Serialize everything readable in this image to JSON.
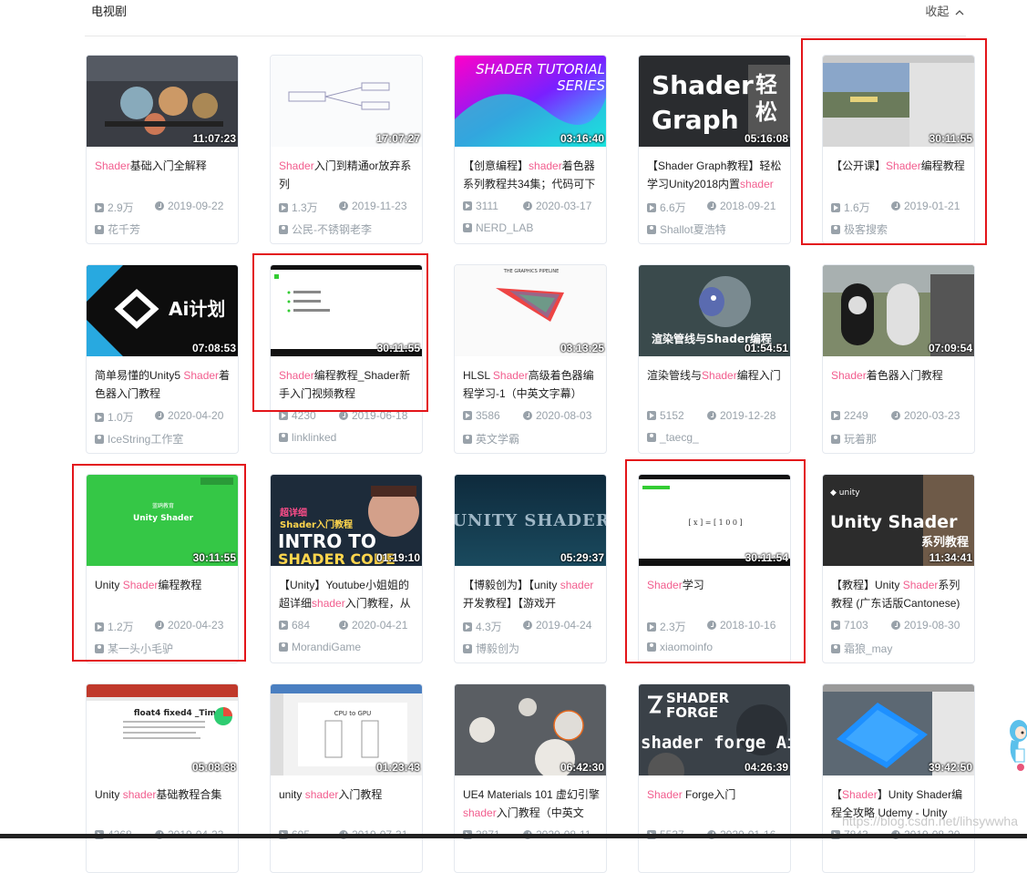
{
  "header": {
    "title": "电视剧",
    "collapse_label": "收起",
    "collapse_icon": "chevron-up-icon"
  },
  "accent_color": "#f25d8e",
  "highlight_color": "#e3151a",
  "watermark": "https://blog.csdn.net/lihsywwha",
  "cards": [
    {
      "duration": "11:07:23",
      "title_kw": "Shader",
      "title_rest": "基础入门全解释",
      "title_pre": "",
      "views": "2.9万",
      "date": "2019-09-22",
      "uploader": "花千芳",
      "thumb": "balls"
    },
    {
      "duration": "17:07:27",
      "title_pre": "",
      "title_kw": "Shader",
      "title_rest": "入门到精通or放弃系列",
      "views": "1.3万",
      "date": "2019-11-23",
      "uploader": "公民-不锈钢老李",
      "thumb": "mindmap"
    },
    {
      "duration": "03:16:40",
      "title_pre": "【创意编程】",
      "title_kw": "shader",
      "title_rest": "着色器系列教程共34集；代码可下",
      "views": "3111",
      "date": "2020-03-17",
      "uploader": "NERD_LAB",
      "thumb": "gradient",
      "thumb_text": "SHADER TUTORIAL SERIES"
    },
    {
      "duration": "05:16:08",
      "title_pre": "【Shader Graph教程】轻松学习Unity2018内置",
      "title_kw": "shader",
      "title_rest": "",
      "views": "6.6万",
      "date": "2018-09-21",
      "uploader": "Shallot夏浩特",
      "thumb": "graph",
      "thumb_text": "Shader Graph 轻松学"
    },
    {
      "duration": "30:11:55",
      "title_pre": "【公开课】",
      "title_kw": "Shader",
      "title_rest": "编程教程",
      "views": "1.6万",
      "date": "2019-01-21",
      "uploader": "极客搜索",
      "thumb": "editor"
    },
    {
      "duration": "07:08:53",
      "title_pre": "简单易懂的Unity5 ",
      "title_kw": "Shader",
      "title_rest": "着色器入门教程",
      "views": "1.0万",
      "date": "2020-04-20",
      "uploader": "IceString工作室",
      "thumb": "ai",
      "thumb_text": "Ai计划"
    },
    {
      "duration": "30:11:55",
      "title_pre": "",
      "title_kw": "Shader",
      "title_rest": "编程教程_Shader新手入门视频教程",
      "views": "4230",
      "date": "2019-06-18",
      "uploader": "linklinked",
      "thumb": "slide"
    },
    {
      "duration": "03:13:25",
      "title_pre": "HLSL ",
      "title_kw": "Shader",
      "title_rest": "高级着色器编程学习-1（中英文字幕）",
      "views": "3586",
      "date": "2020-08-03",
      "uploader": "英文学霸",
      "thumb": "pipeline",
      "thumb_text": "THE GRAPHICS PIPELINE"
    },
    {
      "duration": "01:54:51",
      "title_pre": "渲染管线与",
      "title_kw": "Shader",
      "title_rest": "编程入门",
      "views": "5152",
      "date": "2019-12-28",
      "uploader": "_taecg_",
      "thumb": "robot",
      "thumb_text": "渲染管线与Shader编程"
    },
    {
      "duration": "07:09:54",
      "title_pre": "",
      "title_kw": "Shader",
      "title_rest": "着色器入门教程",
      "views": "2249",
      "date": "2020-03-23",
      "uploader": "玩着那",
      "thumb": "capsules"
    },
    {
      "duration": "30:11:55",
      "title_pre": "Unity ",
      "title_kw": "Shader",
      "title_rest": "编程教程",
      "views": "1.2万",
      "date": "2020-04-23",
      "uploader": "某一头小毛驴",
      "thumb": "green",
      "thumb_text": "Unity Shader"
    },
    {
      "duration": "01:19:10",
      "title_pre": "【Unity】Youtube小姐姐的超详细",
      "title_kw": "shader",
      "title_rest": "入门教程，从",
      "views": "684",
      "date": "2020-04-21",
      "uploader": "MorandiGame",
      "thumb": "intro",
      "thumb_text": "INTRO TO SHADER CODE"
    },
    {
      "duration": "05:29:37",
      "title_pre": "【博毅创为】【unity ",
      "title_kw": "shader",
      "title_rest": "开发教程】【游戏开",
      "views": "4.3万",
      "date": "2019-04-24",
      "uploader": "博毅创为",
      "thumb": "unityshader",
      "thumb_text": "UNITY SHADER"
    },
    {
      "duration": "30:11:54",
      "title_pre": "",
      "title_kw": "Shader",
      "title_rest": "学习",
      "views": "2.3万",
      "date": "2018-10-16",
      "uploader": "xiaomoinfo",
      "thumb": "matrix"
    },
    {
      "duration": "11:34:41",
      "title_pre": "【教程】Unity ",
      "title_kw": "Shader",
      "title_rest": "系列教程 (广东话版Cantonese)",
      "views": "7103",
      "date": "2019-08-30",
      "uploader": "霜狼_may",
      "thumb": "unitydark",
      "thumb_text": "Unity Shader 系列教程"
    },
    {
      "duration": "05:08:38",
      "title_pre": "Unity ",
      "title_kw": "shader",
      "title_rest": "基础教程合集",
      "views": "4268",
      "date": "2019-04-23",
      "uploader": "",
      "thumb": "ppt",
      "thumb_text": "float4 fixed4 _Time"
    },
    {
      "duration": "01:23:43",
      "title_pre": "unity ",
      "title_kw": "shader",
      "title_rest": "入门教程",
      "views": "695",
      "date": "2019-07-31",
      "uploader": "",
      "thumb": "ppt2",
      "thumb_text": "CPU to GPU"
    },
    {
      "duration": "06:42:30",
      "title_pre": "UE4 Materials 101 虚幻引擎",
      "title_kw": "shader",
      "title_rest": "入门教程（中英文",
      "views": "3871",
      "date": "2020-08-11",
      "uploader": "",
      "thumb": "spheres"
    },
    {
      "duration": "04:26:39",
      "title_pre": "",
      "title_kw": "Shader",
      "title_rest": " Forge入门",
      "views": "5537",
      "date": "2020-01-16",
      "uploader": "",
      "thumb": "forge",
      "thumb_text": "SHADER FORGE"
    },
    {
      "duration": "39:42:50",
      "title_pre": "【",
      "title_kw": "Shader",
      "title_rest": "】Unity Shader编程全攻略 Udemy - Unity",
      "views": "7843",
      "date": "2019-08-20",
      "uploader": "",
      "thumb": "water"
    }
  ]
}
